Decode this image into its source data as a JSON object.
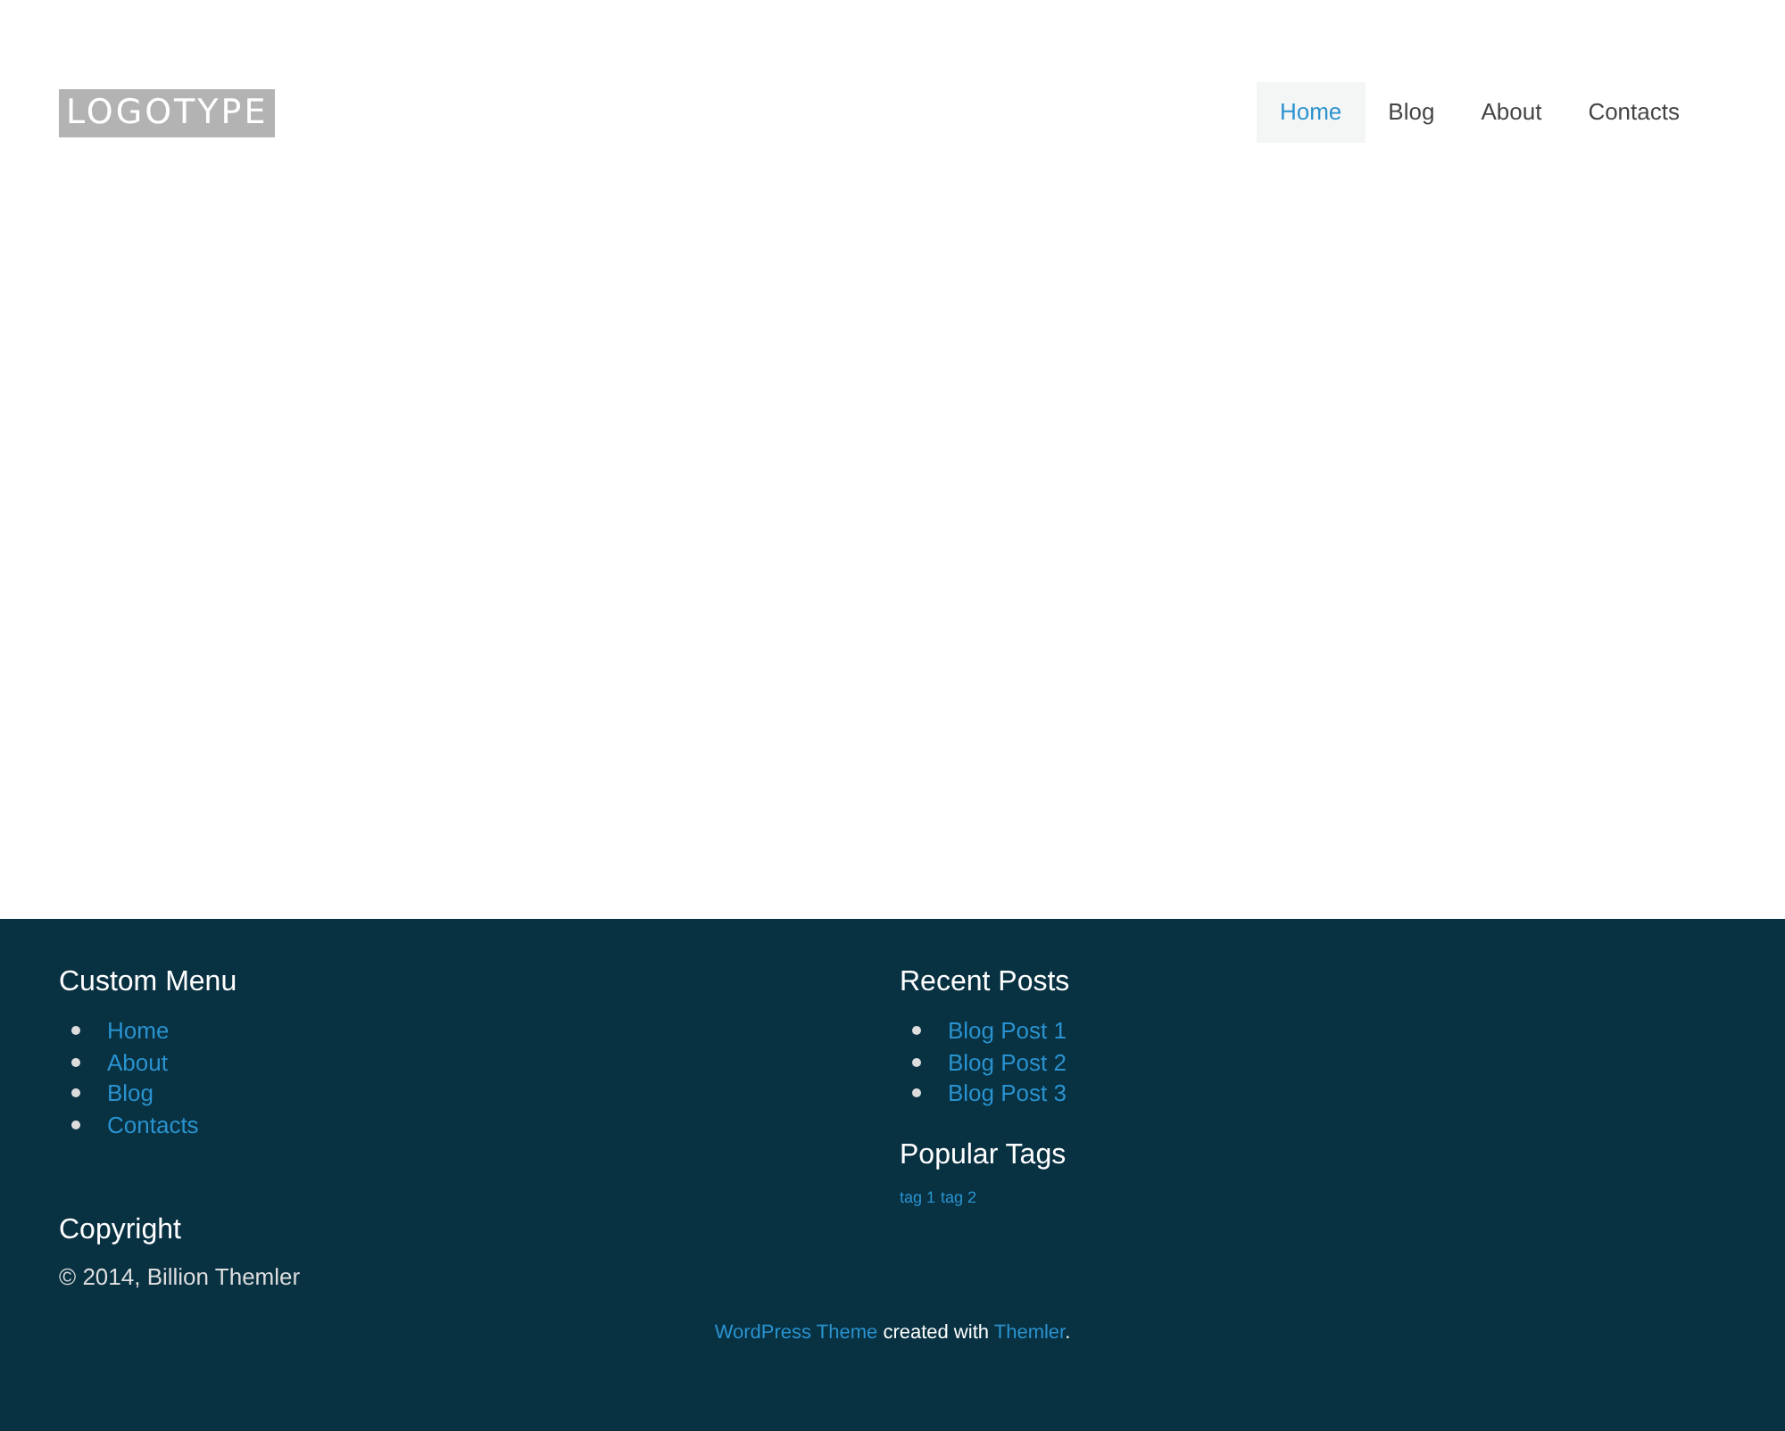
{
  "header": {
    "logo": "LOGOTYPE",
    "nav": [
      {
        "label": "Home",
        "selected": true
      },
      {
        "label": "Blog",
        "selected": false
      },
      {
        "label": "About",
        "selected": false
      },
      {
        "label": "Contacts",
        "selected": false
      }
    ]
  },
  "footer": {
    "custom_menu": {
      "title": "Custom Menu",
      "items": [
        "Home",
        "About",
        "Blog",
        "Contacts"
      ]
    },
    "recent_posts": {
      "title": "Recent Posts",
      "items": [
        "Blog Post 1",
        "Blog Post 2",
        "Blog Post 3"
      ]
    },
    "popular_tags": {
      "title": "Popular Tags",
      "tags": [
        "tag 1",
        "tag 2"
      ]
    },
    "copyright": {
      "title": "Copyright",
      "text": "© 2014, Billion Themler"
    },
    "credits": {
      "link_1": "WordPress Theme",
      "middle": "created with",
      "link_2": "Themler",
      "end": "."
    }
  }
}
